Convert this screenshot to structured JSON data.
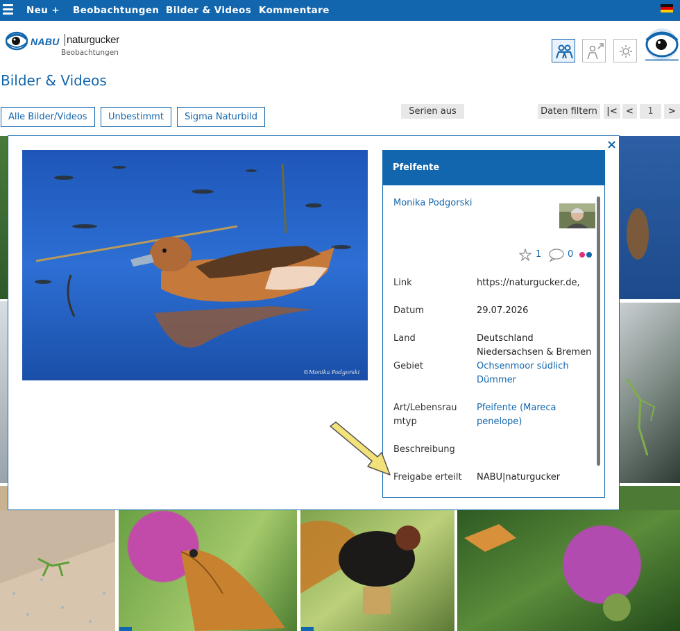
{
  "nav": {
    "items": [
      "Neu +",
      "Beobachtungen",
      "Bilder & Videos",
      "Kommentare"
    ]
  },
  "logo": {
    "nabu": "NABU",
    "brand": "naturgucker",
    "subtitle": "Beobachtungen"
  },
  "page_title": "Bilder & Videos",
  "filters": {
    "buttons": [
      "Alle Bilder/Videos",
      "Unbestimmt",
      "Sigma Naturbild"
    ],
    "series": "Serien aus",
    "data_filter": "Daten filtern",
    "pager": {
      "first": "|<",
      "prev": "<",
      "page": "1",
      "next": ">"
    }
  },
  "modal": {
    "close": "×",
    "panel": {
      "title": "Pfeifente",
      "author": "Monika Podgorski",
      "likes": "1",
      "comments": "0",
      "rows": {
        "link_label": "Link",
        "link_value": "https://naturgucker.de,",
        "date_label": "Datum",
        "date_value": "29.07.2026",
        "country_label": "Land",
        "country_value": "Deutschland",
        "region_value": "Niedersachsen & Bremen",
        "area_label": "Gebiet",
        "area_value_1": "Ochsenmoor südlich",
        "area_value_2": "Dümmer",
        "species_label_1": "Art/Lebensrau",
        "species_label_2": "mtyp",
        "species_value_1": "Pfeifente (Mareca",
        "species_value_2": "penelope)",
        "desc_label": "Beschreibung",
        "release_label": "Freigabe erteilt",
        "release_value": "NABU|naturgucker"
      }
    }
  },
  "colors": {
    "primary": "#1266ad",
    "arrow": "#f3e27a",
    "button_grey": "#e8e8e8"
  },
  "icons": [
    "hamburger-icon",
    "flag-de-icon",
    "users-icon",
    "user-export-icon",
    "settings-icon",
    "star-icon",
    "comment-icon",
    "dots-icon",
    "close-icon"
  ]
}
